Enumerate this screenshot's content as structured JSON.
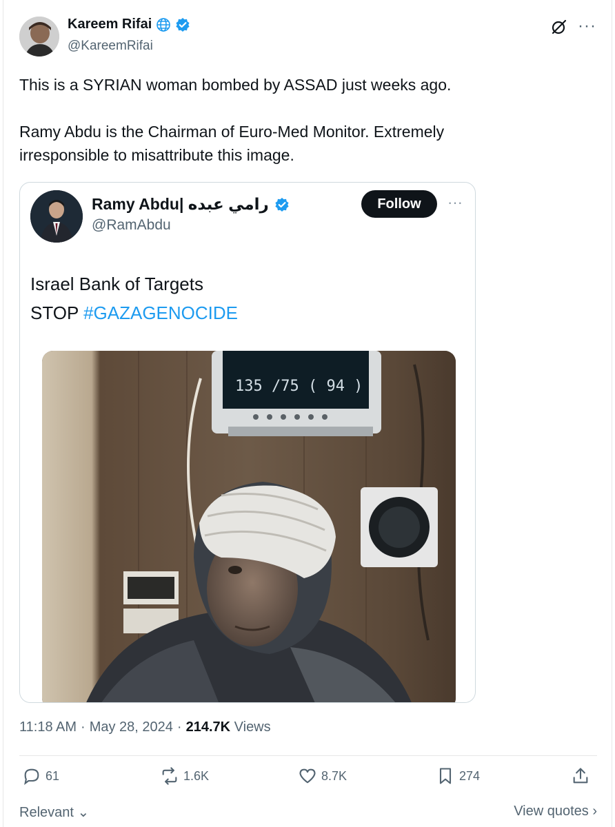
{
  "author": {
    "name": "Kareem Rifai",
    "handle": "@KareemRifai"
  },
  "tweet": {
    "paragraph1": "This is a SYRIAN woman bombed by ASSAD just weeks ago.",
    "paragraph2": "Ramy Abdu is the Chairman of Euro-Med Monitor. Extremely irresponsible to misattribute this image."
  },
  "quoted": {
    "name": "Ramy Abdu| رامي عبده",
    "handle": "@RamAbdu",
    "follow_label": "Follow",
    "line1": "Israel Bank of Targets",
    "line2_prefix": "STOP ",
    "hashtag": "#GAZAGENOCIDE",
    "monitor_reading": "135 /75 ( 94 )"
  },
  "meta": {
    "time": "11:18 AM",
    "sep1": "·",
    "date": "May 28, 2024",
    "sep2": "·",
    "views_count": "214.7K",
    "views_label": "Views"
  },
  "actions": {
    "replies": "61",
    "reposts": "1.6K",
    "likes": "8.7K",
    "bookmarks": "274"
  },
  "footer": {
    "sort_label": "Relevant",
    "view_quotes": "View quotes"
  },
  "colors": {
    "text": "#0f1419",
    "secondary": "#536471",
    "accent": "#1d9bf0",
    "border": "#cfd9de"
  }
}
